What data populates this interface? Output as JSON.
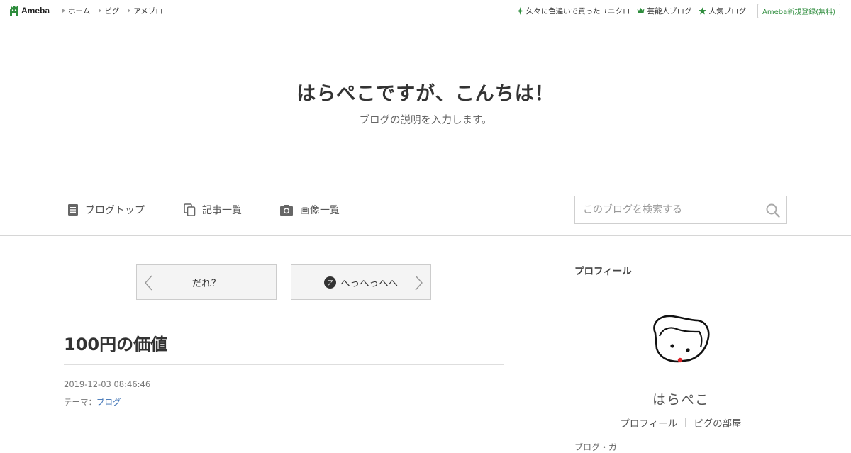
{
  "global_header": {
    "logo_text": "Ameba",
    "nav": [
      "ホーム",
      "ピグ",
      "アメブロ"
    ],
    "right_links": [
      {
        "label": "久々に色違いで買ったユニクロ",
        "icon": "sparkle-icon"
      },
      {
        "label": "芸能人ブログ",
        "icon": "crown-icon"
      },
      {
        "label": "人気ブログ",
        "icon": "star-icon"
      }
    ],
    "register_label": "Ameba新規登録(無料)",
    "brand_color": "#2d8c3c"
  },
  "blog": {
    "title": "はらぺこですが、こんちは！",
    "description": "ブログの説明を入力します。"
  },
  "nav": {
    "items": [
      {
        "label": "ブログトップ",
        "icon": "document-icon"
      },
      {
        "label": "記事一覧",
        "icon": "copy-icon"
      },
      {
        "label": "画像一覧",
        "icon": "camera-icon"
      }
    ],
    "search_placeholder": "このブログを検索する"
  },
  "pager": {
    "prev_label": "だれ？",
    "next_label": "へっへっへへ",
    "next_badge": "ア"
  },
  "entry": {
    "title": "100円の価値",
    "date": "2019-12-03 08:46:46",
    "theme_label": "テーマ：",
    "theme_value": "ブログ"
  },
  "sidebar": {
    "heading": "プロフィール",
    "name": "はらぺこ",
    "links": [
      "プロフィール",
      "ピグの部屋"
    ],
    "next_heading_partial": "ブログ・ガ"
  }
}
